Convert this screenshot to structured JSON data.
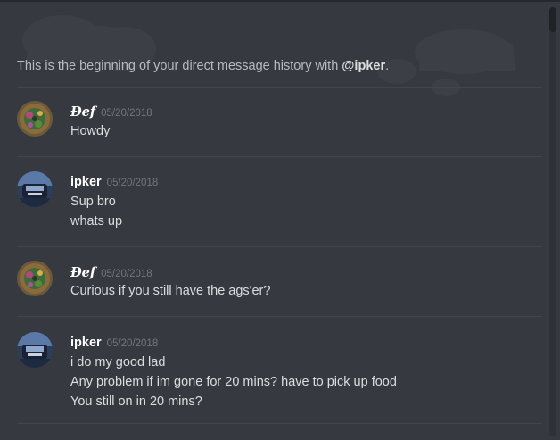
{
  "intro": {
    "prefix": "This is the beginning of your direct message history with ",
    "user": "@ipker",
    "suffix": "."
  },
  "messages": [
    {
      "author": "Đef",
      "timestamp": "05/20/2018",
      "avatar": "def-avatar",
      "lines": [
        "Howdy"
      ]
    },
    {
      "author": "ipker",
      "timestamp": "05/20/2018",
      "avatar": "ipker-avatar",
      "lines": [
        "Sup bro",
        "whats up"
      ]
    },
    {
      "author": "Đef",
      "timestamp": "05/20/2018",
      "avatar": "def-avatar",
      "lines": [
        "Curious if you still have the ags'er?"
      ]
    },
    {
      "author": "ipker",
      "timestamp": "05/20/2018",
      "avatar": "ipker-avatar",
      "lines": [
        "i do my good lad",
        "Any problem if im gone for 20 mins? have to pick up food",
        "You still on in 20 mins?"
      ]
    }
  ],
  "colors": {
    "background": "#36393f",
    "text": "#dcddde",
    "muted": "#72767d",
    "divider": "#42454a"
  }
}
